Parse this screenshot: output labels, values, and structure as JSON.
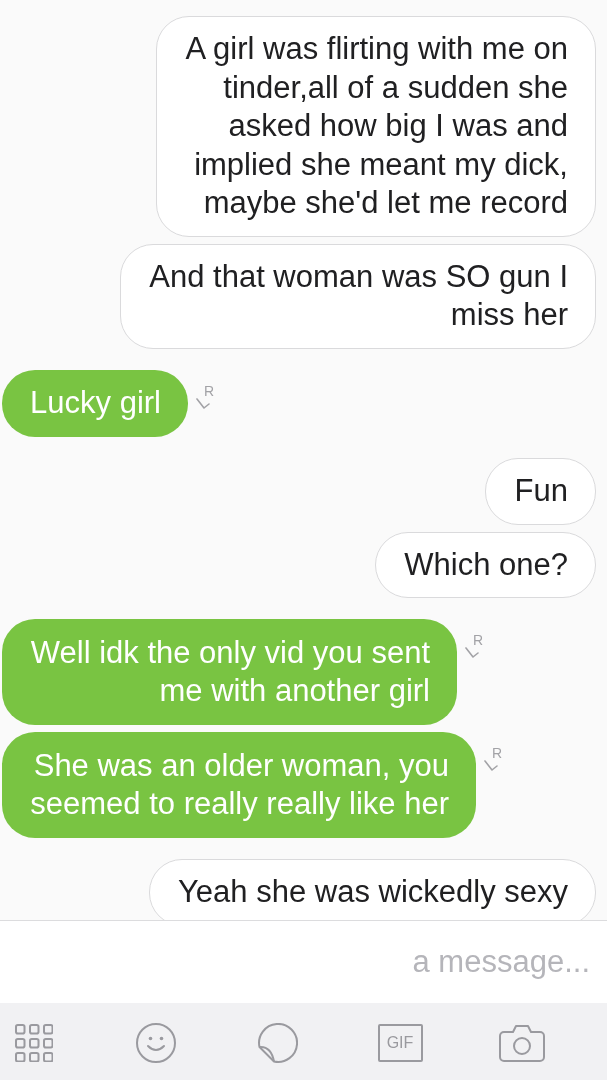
{
  "messages": [
    {
      "kind": "received",
      "text": "A girl was flirting with me on tinder,all of a sudden she asked how big I was and implied she meant my dick, maybe she'd let me record"
    },
    {
      "kind": "received",
      "text": "And that woman was SO gun I miss her"
    },
    {
      "kind": "sent",
      "text": "Lucky girl",
      "receipt": "R"
    },
    {
      "kind": "received",
      "text": "Fun"
    },
    {
      "kind": "received",
      "text": "Which one?"
    },
    {
      "kind": "sent",
      "text": "Well idk the only vid you sent me with another girl",
      "receipt": "R"
    },
    {
      "kind": "sent",
      "text": "She was an older woman, you seemed to really really like her",
      "receipt": "R"
    },
    {
      "kind": "received",
      "text": "Yeah she was wickedly sexy"
    }
  ],
  "composer": {
    "placeholder": "a message..."
  },
  "toolbar": [
    {
      "kind": "apps"
    },
    {
      "kind": "emoji"
    },
    {
      "kind": "sticker"
    },
    {
      "kind": "gif",
      "label": "GIF"
    },
    {
      "kind": "camera"
    }
  ]
}
